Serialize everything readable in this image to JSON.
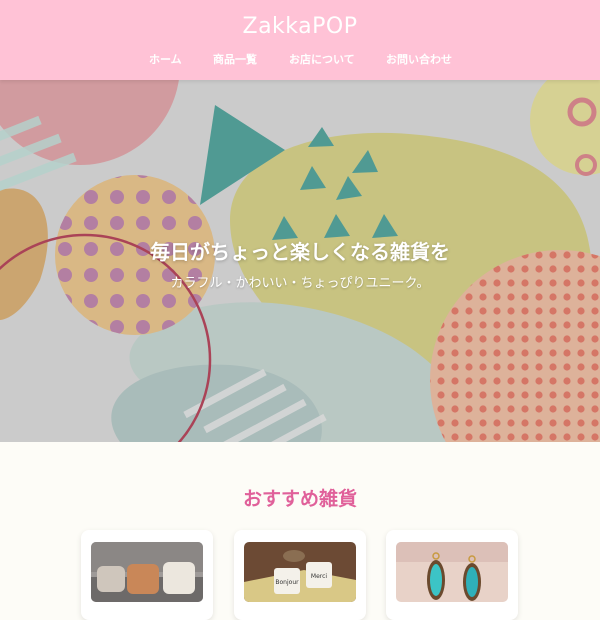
{
  "site": {
    "title": "ZakkaPOP"
  },
  "nav": {
    "items": [
      "ホーム",
      "商品一覧",
      "お店について",
      "お問い合わせ"
    ]
  },
  "hero": {
    "title": "毎日がちょっと楽しくなる雑貨を",
    "subtitle": "カラフル・かわいい・ちょっぴりユニーク。"
  },
  "featured": {
    "heading": "おすすめ雑貨",
    "products": [
      {
        "image": "cushions-on-sofa"
      },
      {
        "image": "bonjour-merci-mugs",
        "mug_texts": [
          "Bonjour",
          "Merci"
        ]
      },
      {
        "image": "turquoise-earrings"
      }
    ]
  },
  "colors": {
    "header": "#ffc2d6",
    "accent": "#e0609a",
    "background": "#fdfcf7"
  }
}
